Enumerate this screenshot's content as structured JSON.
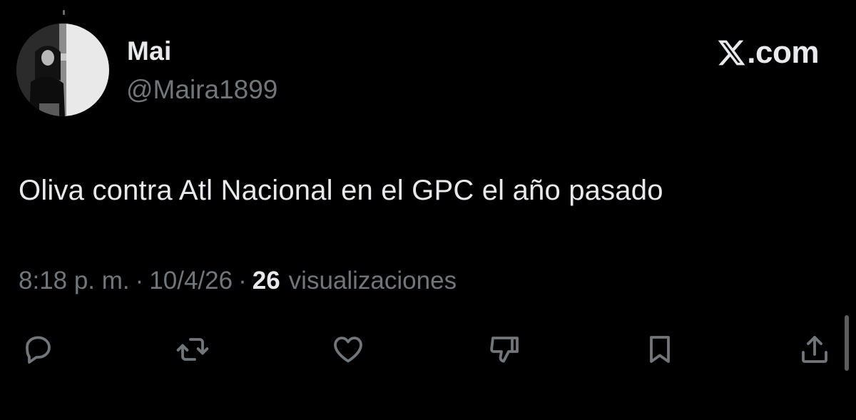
{
  "author": {
    "display_name": "Mai",
    "handle": "@Maira1899"
  },
  "brand": {
    "text": ".com",
    "logo_icon": "x-logo-icon"
  },
  "tweet": {
    "text": "Oliva contra Atl Nacional en el GPC el año pasado"
  },
  "meta": {
    "time": "8:18 p. m.",
    "separator": "·",
    "date": "10/4/26",
    "views_count": "26",
    "views_label": "visualizaciones"
  },
  "actions": [
    {
      "name": "reply",
      "icon": "reply-bubble-icon"
    },
    {
      "name": "repost",
      "icon": "repost-arrows-icon"
    },
    {
      "name": "like",
      "icon": "heart-icon"
    },
    {
      "name": "dislike",
      "icon": "thumbs-down-icon"
    },
    {
      "name": "bookmark",
      "icon": "bookmark-icon"
    },
    {
      "name": "share",
      "icon": "share-upload-icon"
    }
  ],
  "colors": {
    "background": "#000000",
    "primary_text": "#e7e9ea",
    "secondary_text": "#71767b",
    "icon": "#71767b"
  }
}
